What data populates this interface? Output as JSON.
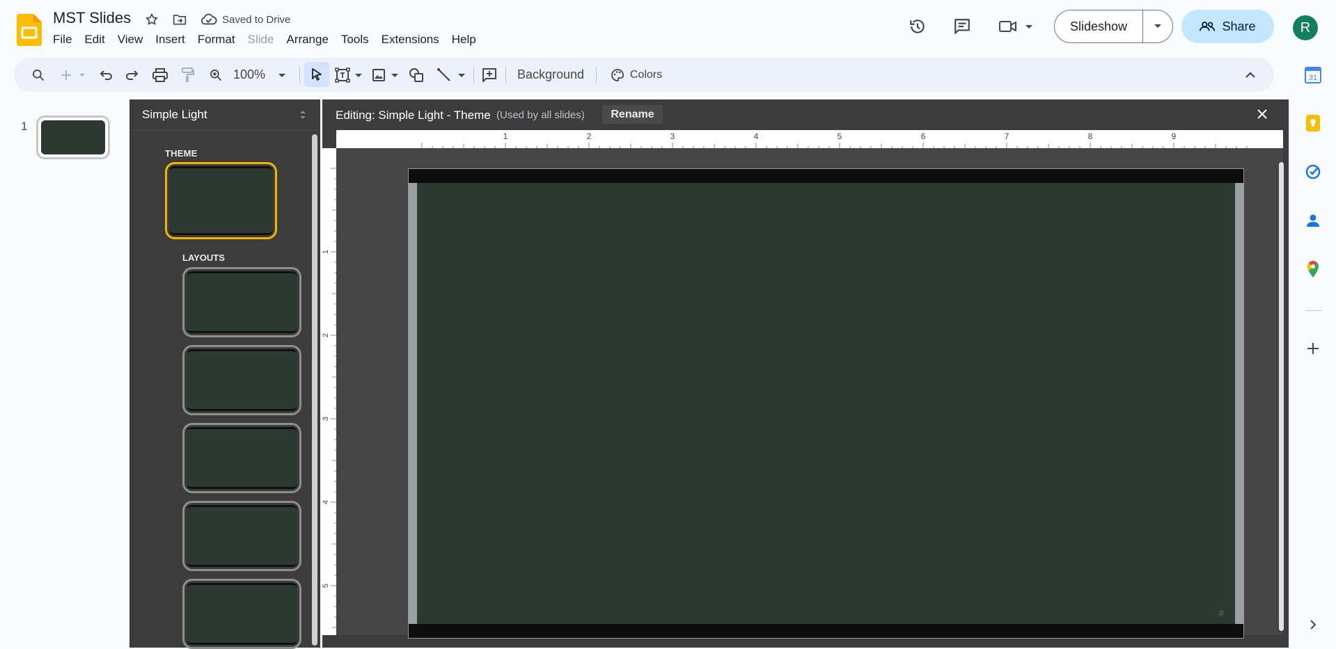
{
  "app": {
    "title": "MST Slides",
    "saved_status": "Saved to Drive",
    "menu": [
      {
        "label": "File",
        "disabled": false
      },
      {
        "label": "Edit",
        "disabled": false
      },
      {
        "label": "View",
        "disabled": false
      },
      {
        "label": "Insert",
        "disabled": false
      },
      {
        "label": "Format",
        "disabled": false
      },
      {
        "label": "Slide",
        "disabled": true
      },
      {
        "label": "Arrange",
        "disabled": false
      },
      {
        "label": "Tools",
        "disabled": false
      },
      {
        "label": "Extensions",
        "disabled": false
      },
      {
        "label": "Help",
        "disabled": false
      }
    ],
    "slideshow_label": "Slideshow",
    "share_label": "Share",
    "avatar_initial": "R",
    "brand_color": "#fbbc04"
  },
  "toolbar": {
    "zoom": "100%",
    "background_label": "Background",
    "colors_label": "Colors"
  },
  "filmstrip": {
    "slides": [
      {
        "number": "1"
      }
    ]
  },
  "theme_panel": {
    "theme_name": "Simple Light",
    "theme_section": "THEME",
    "layouts_section": "LAYOUTS",
    "layout_count": 5
  },
  "editor": {
    "editing_title": "Editing: Simple Light - Theme",
    "editing_sub": "(Used by all slides)",
    "rename_label": "Rename",
    "ruler_h": [
      "1",
      "2",
      "3",
      "4",
      "5",
      "6",
      "7",
      "8",
      "9"
    ],
    "ruler_v": [
      "1",
      "2",
      "3",
      "4",
      "5"
    ],
    "slide_number_placeholder": "#",
    "slide_bg_color": "#2c3930"
  },
  "side_panel": {
    "icons": [
      "calendar-icon",
      "keep-icon",
      "tasks-icon",
      "contacts-icon",
      "maps-icon",
      "add-icon"
    ],
    "calendar_day": "31"
  }
}
